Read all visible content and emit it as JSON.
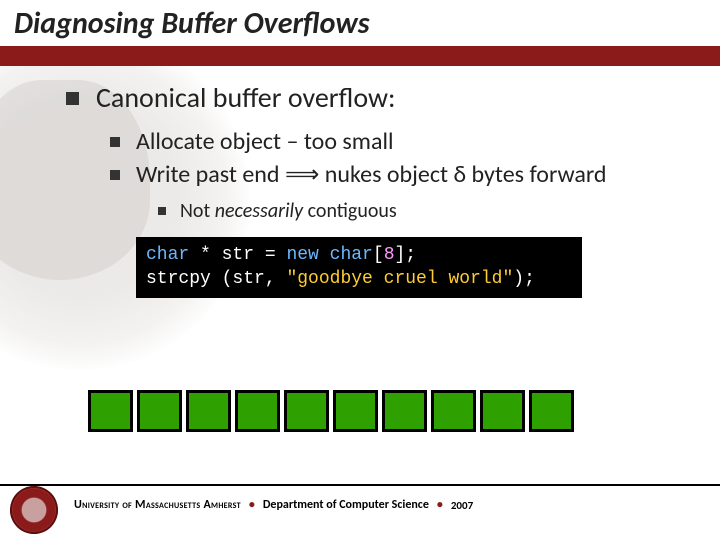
{
  "title": "Diagnosing Buffer Overflows",
  "bullets": {
    "l1": "Canonical buffer overflow:",
    "l2a": "Allocate object – too small",
    "l2b_pre": "Write past end ",
    "l2b_arrow": "⟹",
    "l2b_mid": " nukes object ",
    "l2b_delta": "δ",
    "l2b_post": " bytes forward",
    "l3_pre": "Not ",
    "l3_em": "necessarily",
    "l3_post": " contiguous"
  },
  "code": {
    "line1": {
      "t1": "char",
      "t2": " * str = ",
      "t3": "new",
      "t4": " ",
      "t5": "char",
      "t6": "[",
      "t7": "8",
      "t8": "];"
    },
    "line2": {
      "t1": "strcpy (str, ",
      "t2": "\"goodbye cruel world\"",
      "t3": ");"
    }
  },
  "buffer_cells": 10,
  "footer": {
    "university_caps": "University of Massachusetts Amherst",
    "dept": "Department of Computer Science",
    "year": "2007"
  }
}
